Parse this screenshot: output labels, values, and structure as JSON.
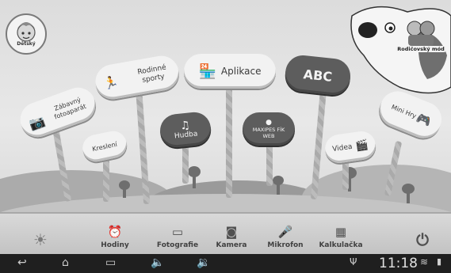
{
  "profile": {
    "label": "Dětský"
  },
  "parent_mode": {
    "label": "Rodičovský mód"
  },
  "signs": {
    "camera_fun": "Zábavný fotoaparát",
    "family_sports": "Rodinné sporty",
    "apps": "Aplikace",
    "drawing": "Kreslení",
    "music": "Hudba",
    "maxipes": "MAXIPES FÍK WEB",
    "videos": "Videa",
    "mini_games": "Mini Hry"
  },
  "dock": {
    "clock_label": "Hodiny",
    "photos_label": "Fotografie",
    "camera_label": "Kamera",
    "mic_label": "Mikrofon",
    "calc_label": "Kalkulačka"
  },
  "status": {
    "time": "11:18"
  },
  "icons": [
    "back-icon",
    "home-icon",
    "recent-apps-icon",
    "volume-down-icon",
    "volume-up-icon",
    "usb-icon",
    "wifi-icon",
    "battery-icon",
    "brightness-icon",
    "power-icon"
  ]
}
